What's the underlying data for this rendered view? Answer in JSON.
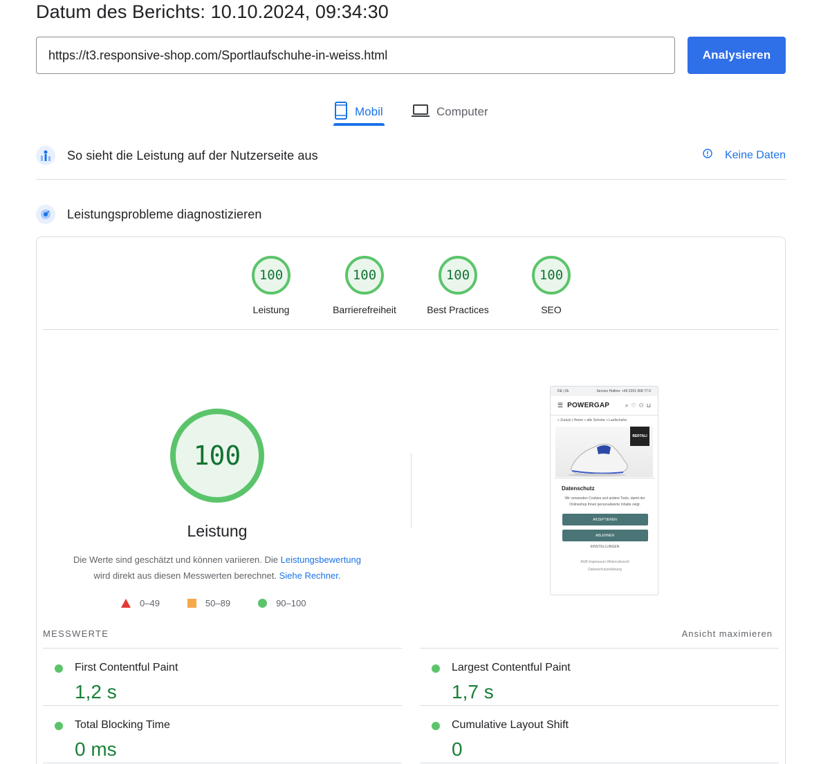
{
  "header": {
    "report_date": "Datum des Berichts: 10.10.2024, 09:34:30"
  },
  "search": {
    "url": "https://t3.responsive-shop.com/Sportlaufschuhe-in-weiss.html",
    "analyze_label": "Analysieren"
  },
  "tabs": [
    {
      "label": "Mobil",
      "active": true
    },
    {
      "label": "Computer",
      "active": false
    }
  ],
  "field_data": {
    "title": "So sieht die Leistung auf der Nutzerseite aus",
    "status": "Keine Daten"
  },
  "diagnose": {
    "title": "Leistungsprobleme diagnostizieren"
  },
  "scores": [
    {
      "label": "Leistung",
      "value": "100"
    },
    {
      "label": "Barrierefreiheit",
      "value": "100"
    },
    {
      "label": "Best Practices",
      "value": "100"
    },
    {
      "label": "SEO",
      "value": "100"
    }
  ],
  "performance": {
    "score": "100",
    "label": "Leistung",
    "desc_1": "Die Werte sind geschätzt und können variieren. Die ",
    "desc_link_1": "Leistungsbewertung",
    "desc_2": "wird direkt aus diesen Messwerten berechnet. ",
    "desc_link_2": "Siehe Rechner",
    "desc_3": "."
  },
  "legend": [
    {
      "range": "0–49",
      "color": "#e53935"
    },
    {
      "range": "50–89",
      "color": "#f6a84b"
    },
    {
      "range": "90–100",
      "color": "#5bc46b"
    }
  ],
  "preview": {
    "topbar_left": "DE | €k",
    "topbar_right": "Service Hotline: +49 2291 908 77-0",
    "brand": "POWERGAP",
    "breadcrumb": "« Zurück | Home » alle Schuhe » Laufschuhe",
    "badge": "BERTALI",
    "dialog_title": "Datenschutz",
    "dialog_text": "Wir verwenden Cookies und andere Tools, damit der Onlineshop Ihnen personalisierte Inhalte zeigt.",
    "accept": "AKZEPTIEREN",
    "decline": "ABLEHNEN",
    "settings": "EINSTELLUNGEN",
    "links_1": "AGB  Impressum  Widerrufsrecht",
    "links_2": "Datenschutzerklärung"
  },
  "metrics": {
    "title": "MESSWERTE",
    "expand": "Ansicht maximieren",
    "items": [
      {
        "name": "First Contentful Paint",
        "value": "1,2 s"
      },
      {
        "name": "Largest Contentful Paint",
        "value": "1,7 s"
      },
      {
        "name": "Total Blocking Time",
        "value": "0 ms"
      },
      {
        "name": "Cumulative Layout Shift",
        "value": "0"
      }
    ]
  }
}
